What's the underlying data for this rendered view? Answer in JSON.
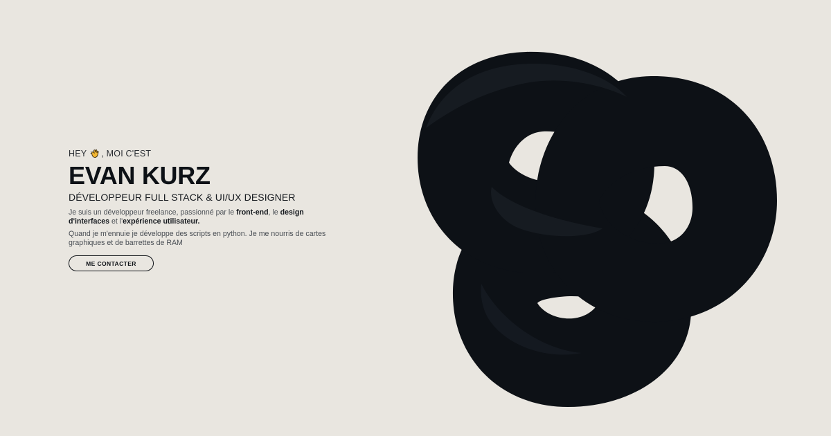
{
  "hero": {
    "greeting_prefix": "HEY",
    "greeting_icon": "waving-hand-icon",
    "greeting_suffix": ", MOI C'EST",
    "name": "EVAN KURZ",
    "role": "DÉVELOPPEUR FULL STACK & UI/UX DESIGNER",
    "description_1": {
      "part1": "Je suis un développeur freelance, passionné par le ",
      "bold1": "front-end",
      "part2": ", le ",
      "bold2": "design d'interfaces",
      "part3": " et l'",
      "bold3": "expérience utilisateur."
    },
    "description_2": "Quand je m'ennuie je développe des scripts en python. Je me nourris de cartes graphiques et de barrettes de RAM",
    "contact_button": "ME CONTACTER"
  },
  "artwork": {
    "icon": "dark-torus-knot",
    "fill_color": "#0d1116",
    "background_color": "#e9e6e0"
  }
}
